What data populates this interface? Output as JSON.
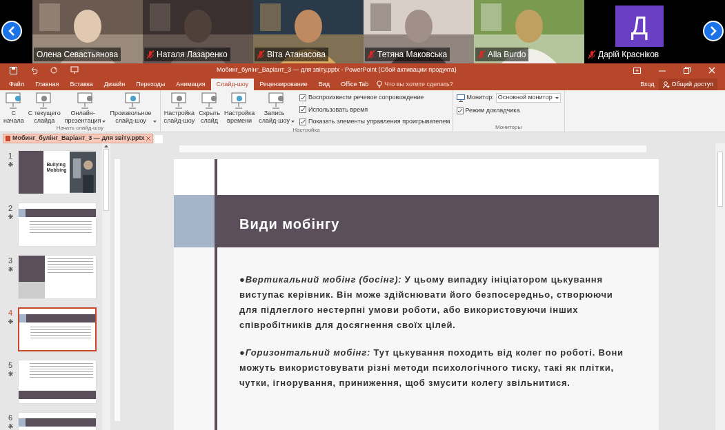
{
  "call": {
    "participants": [
      {
        "name": "Олена Севастьянова",
        "muted": false,
        "kind": "video"
      },
      {
        "name": "Наталя Лазаренко",
        "muted": true,
        "kind": "video"
      },
      {
        "name": "Віта Атанасова",
        "muted": true,
        "kind": "video"
      },
      {
        "name": "Тетяна Маковська",
        "muted": true,
        "kind": "video"
      },
      {
        "name": "Alla Burdo",
        "muted": true,
        "kind": "video"
      },
      {
        "name": "Дарій Красніков",
        "muted": true,
        "kind": "initial",
        "initial": "Д"
      }
    ]
  },
  "window": {
    "title": "Мобинг_булінг_Варіант_3 — для звіту.pptx - PowerPoint (Сбой активации продукта)"
  },
  "ribbon_tabs": [
    {
      "label": "Файл",
      "selected": false
    },
    {
      "label": "Главная",
      "selected": false
    },
    {
      "label": "Вставка",
      "selected": false
    },
    {
      "label": "Дизайн",
      "selected": false
    },
    {
      "label": "Переходы",
      "selected": false
    },
    {
      "label": "Анимация",
      "selected": false
    },
    {
      "label": "Слайд-шоу",
      "selected": true
    },
    {
      "label": "Рецензирование",
      "selected": false
    },
    {
      "label": "Вид",
      "selected": false
    },
    {
      "label": "Office Tab",
      "selected": false
    }
  ],
  "tell_me": {
    "placeholder": "Что вы хотите сделать?"
  },
  "account": {
    "sign_in": "Вход",
    "share": "Общий доступ"
  },
  "ribbon_groups": [
    {
      "label": "Начать слайд-шоу",
      "buttons": [
        {
          "label": "С\nначала",
          "dropdown": false
        },
        {
          "label": "С текущего\nслайда",
          "dropdown": false
        },
        {
          "label": "Онлайн-\nпрезентация",
          "dropdown": true
        },
        {
          "label": "Произвольное\nслайд-шоу",
          "dropdown": true
        }
      ]
    },
    {
      "label": "Настройка",
      "buttons": [
        {
          "label": "Настройка\nслайд-шоу",
          "dropdown": false
        },
        {
          "label": "Скрыть\nслайд",
          "dropdown": false
        },
        {
          "label": "Настройка\nвремени",
          "dropdown": false
        },
        {
          "label": "Запись\nслайд-шоу",
          "dropdown": true
        }
      ],
      "checks": [
        {
          "label": "Воспроизвести речевое сопровождение",
          "checked": true
        },
        {
          "label": "Использовать время",
          "checked": true
        },
        {
          "label": "Показать элементы управления проигрывателем",
          "checked": true
        }
      ]
    },
    {
      "label": "Мониторы",
      "monitor_label": "Монитор:",
      "monitor_value": "Основной монитор",
      "checks": [
        {
          "label": "Режим докладчика",
          "checked": true
        }
      ]
    }
  ],
  "doc_tab": {
    "label": "Мобинг_булінг_Варіант_3 — для звіту.pptx"
  },
  "thumbnails": [
    {
      "number": "1",
      "selected": false,
      "kind": "title",
      "title": "Bullying\nMobbing"
    },
    {
      "number": "2",
      "selected": false,
      "kind": "band_top"
    },
    {
      "number": "3",
      "selected": false,
      "kind": "side"
    },
    {
      "number": "4",
      "selected": true,
      "kind": "band_top"
    },
    {
      "number": "5",
      "selected": false,
      "kind": "band_bottom"
    },
    {
      "number": "6",
      "selected": false,
      "kind": "band_top"
    }
  ],
  "slide": {
    "title": "Види мобінгу",
    "paragraphs": [
      "●*Вертикальний мобінг (босінг):* У цьому випадку ініціатором цькування виступає керівник. Він може здійснювати його безпосередньо, створюючи для підлеглого нестерпні умови роботи, або використовуючи інших співробітників для досягнення своїх цілей.",
      "●*Горизонтальний мобінг:* Тут цькування походить від колег по роботі. Вони можуть використовувати різні методи психологічного тиску, такі як плітки, чутки, ігнорування, приниження, щоб змусити колегу звільнитися."
    ]
  }
}
